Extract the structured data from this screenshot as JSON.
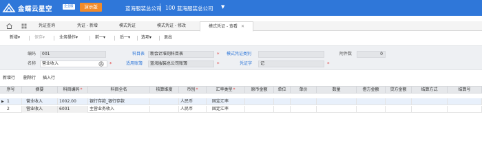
{
  "topbar": {
    "brand": "金蝶云星空",
    "badge": "企业版",
    "demo": "演示版",
    "org": "蓝海服装总公司",
    "org_code": "100",
    "org_name": "蓝海服装总公司",
    "caret": "▼"
  },
  "tabs": [
    {
      "label": "凭证查询"
    },
    {
      "label": "凭证 - 新增"
    },
    {
      "label": "模式凭证"
    },
    {
      "label": "模式凭证 - 修改"
    },
    {
      "label": "模式凭证 - 查看"
    }
  ],
  "tab_close": "✕",
  "toolbar": [
    {
      "label": "新增",
      "caret": "▾"
    },
    {
      "label": "保存",
      "caret": "▾"
    },
    {
      "label": "业务操作",
      "caret": "▾"
    },
    {
      "label": "前一",
      "caret": "▾"
    },
    {
      "label": "后一",
      "caret": "▾"
    },
    {
      "label": "选项",
      "caret": "▾"
    },
    {
      "label": "退出",
      "caret": ""
    }
  ],
  "form": {
    "code_label": "编码",
    "code_value": "001",
    "name_label": "名称",
    "name_value": "营业收入",
    "chart_label": "科目表",
    "chart_value": "新会计准则科目表",
    "book_label": "适用账簿",
    "book_value": "蓝海服装总公司账簿",
    "category_label": "模式凭证类别",
    "category_value": "",
    "word_label": "凭证字",
    "word_value": "记",
    "attach_label": "附件数",
    "attach_value": "0",
    "required_mark": "*"
  },
  "grid_tools": [
    "新增行",
    "删除行",
    "插入行"
  ],
  "columns": [
    "序号",
    "摘要",
    "科目编码",
    "科目全名",
    "核算维度",
    "币别",
    "汇率类型",
    "原币金额",
    "单位",
    "单价",
    "数量",
    "借方金额",
    "贷方金额",
    "结算方式",
    "结算号"
  ],
  "rows": [
    {
      "seq": "1",
      "summary": "营业收入",
      "code": "1002.00",
      "fullname": "银行存款_银行存款",
      "dim": "",
      "currency": "人民币",
      "rate": "固定汇率",
      "marker": "▶"
    },
    {
      "seq": "2",
      "summary": "营业收入",
      "code": "6001",
      "fullname": "主营业务收入",
      "dim": "",
      "currency": "人民币",
      "rate": "固定汇率",
      "marker": ""
    }
  ]
}
